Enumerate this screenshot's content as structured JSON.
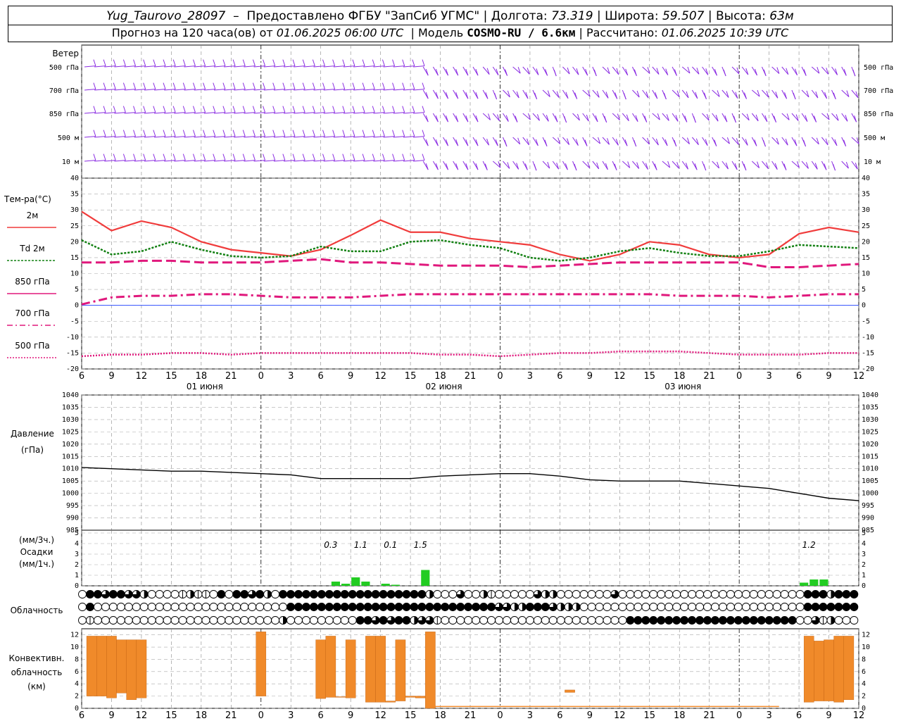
{
  "header": {
    "station": "Yug_Taurovo_28097",
    "provider": "Предоставлено ФГБУ \"ЗапСиб УГМС\"",
    "lon_label": "Долгота:",
    "lon": "73.319",
    "lat_label": "Широта:",
    "lat": "59.507",
    "alt_label": "Высота:",
    "alt": "63м",
    "forecast_label": "Прогноз на 120 часа(ов) от",
    "forecast_start": "01.06.2025 06:00 UTC",
    "model_label": "Модель",
    "model": "COSMO-RU / 6.6км",
    "calc_label": "Рассчитано:",
    "calc_time": "01.06.2025 10:39 UTC"
  },
  "labels": {
    "wind": "Ветер",
    "wind_levels": [
      "500 гПа",
      "700 гПа",
      "850 гПа",
      "500 м",
      "10 м"
    ],
    "temp": "Тем-ра(°С)",
    "legend": [
      "2м",
      "Td 2м",
      "850 гПа",
      "700 гПа",
      "500 гПа"
    ],
    "pressure": [
      "Давление",
      "(гПа)"
    ],
    "precip": [
      "(мм/3ч.)",
      "Осадки",
      "(мм/1ч.)"
    ],
    "cloud": "Облачность",
    "conv": [
      "Конвективн.",
      "облачность",
      "(км)"
    ],
    "days": [
      "01 июня",
      "02 июня",
      "03 июня"
    ]
  },
  "colors": {
    "t2m": "#f03c3c",
    "td": "#128012",
    "t850": "#e0187c",
    "t700": "#e0187c",
    "t500": "#e0187c",
    "wind": "#8a2be2",
    "precip": "#22cc22",
    "conv": "#f08a2a",
    "pressure": "#000000"
  },
  "chart_data": [
    {
      "type": "line",
      "title": "Тем-ра(°С)",
      "x_ticks": [
        "6",
        "9",
        "12",
        "15",
        "18",
        "21",
        "0",
        "3",
        "6",
        "9",
        "12",
        "15",
        "18",
        "21",
        "0",
        "3",
        "6",
        "9",
        "12",
        "15",
        "18",
        "21",
        "0",
        "3",
        "6",
        "9",
        "12"
      ],
      "hours_from_start": [
        0,
        3,
        6,
        9,
        12,
        15,
        18,
        21,
        24,
        27,
        30,
        33,
        36,
        39,
        42,
        45,
        48,
        51,
        54,
        57,
        60,
        63,
        66,
        69,
        72,
        75,
        78
      ],
      "ylim": [
        -20,
        40
      ],
      "series": [
        {
          "name": "2м",
          "values": [
            29.5,
            23.5,
            26.5,
            24.5,
            20,
            17.5,
            16.5,
            15.5,
            17.5,
            22,
            26.8,
            23,
            23,
            21,
            20,
            19,
            16,
            14,
            16,
            20,
            19,
            16,
            15,
            16,
            22.5,
            24.5,
            23
          ]
        },
        {
          "name": "Td 2м",
          "values": [
            20.5,
            16,
            17,
            20,
            17.5,
            15.5,
            15,
            15.5,
            18.5,
            17,
            17,
            20,
            20.5,
            19,
            18,
            15,
            14,
            15,
            17,
            18,
            16.5,
            15.5,
            15.5,
            17,
            19,
            18.5,
            18
          ]
        },
        {
          "name": "850 гПа",
          "values": [
            13.5,
            13.5,
            14,
            14,
            13.5,
            13.5,
            13.5,
            14,
            14.5,
            13.5,
            13.5,
            13,
            12.5,
            12.5,
            12.5,
            12,
            12.5,
            13,
            13.5,
            13.5,
            13.5,
            13.5,
            13.5,
            12,
            12,
            12.5,
            13
          ]
        },
        {
          "name": "700 гПа",
          "values": [
            0.3,
            2.5,
            3,
            3,
            3.5,
            3.5,
            3,
            2.5,
            2.5,
            2.5,
            3,
            3.5,
            3.5,
            3.5,
            3.5,
            3.5,
            3.5,
            3.5,
            3.5,
            3.5,
            3,
            3,
            3,
            2.5,
            3,
            3.5,
            3.5
          ]
        },
        {
          "name": "500 гПа",
          "values": [
            -16,
            -15.5,
            -15.5,
            -15,
            -15,
            -15.5,
            -15,
            -15,
            -15,
            -15,
            -15,
            -15,
            -15.5,
            -15.5,
            -16,
            -15.5,
            -15,
            -15,
            -14.5,
            -14.5,
            -14.5,
            -15,
            -15.5,
            -15.5,
            -15.5,
            -15,
            -15
          ]
        }
      ]
    },
    {
      "type": "line",
      "title": "Давление (гПа)",
      "hours_from_start": [
        0,
        3,
        6,
        9,
        12,
        15,
        18,
        21,
        24,
        27,
        30,
        33,
        36,
        39,
        42,
        45,
        48,
        51,
        54,
        57,
        60,
        63,
        66,
        69,
        72,
        75,
        78
      ],
      "ylim": [
        985,
        1040
      ],
      "y_ticks": [
        985,
        990,
        995,
        1000,
        1005,
        1010,
        1015,
        1020,
        1025,
        1030,
        1035,
        1040
      ],
      "series": [
        {
          "name": "",
          "values": [
            1010.5,
            1010,
            1009.5,
            1009,
            1009,
            1008.5,
            1008,
            1007.5,
            1006,
            1006,
            1006,
            1006,
            1007,
            1007.5,
            1008,
            1008,
            1007,
            1005.5,
            1005,
            1005,
            1005,
            1004,
            1003,
            1002,
            1000,
            998,
            997
          ]
        }
      ]
    },
    {
      "type": "bar",
      "title": "Осадки",
      "ylim": [
        0,
        5
      ],
      "y_ticks": [
        0,
        1,
        2,
        3,
        4,
        5
      ],
      "hours_from_start": [
        25.5,
        26.5,
        27.5,
        28.5,
        29.5,
        30.5,
        31.5,
        32.5,
        33.5,
        34.5,
        72.5,
        73.5,
        74.5
      ],
      "values_mm_1h": [
        0.4,
        0.2,
        0.8,
        0.4,
        0,
        0.2,
        0.1,
        0,
        0,
        1.5,
        0.3,
        0.6,
        0.6
      ],
      "labels_3h": [
        {
          "hour": 25,
          "text": "0.3"
        },
        {
          "hour": 28,
          "text": "1.1"
        },
        {
          "hour": 31,
          "text": "0.1"
        },
        {
          "hour": 34,
          "text": "1.5"
        },
        {
          "hour": 73,
          "text": "1.2"
        }
      ]
    },
    {
      "type": "heatmap",
      "title": "Облачность",
      "rows": [
        "upper",
        "middle",
        "lower"
      ],
      "levels_note": "0=clear,1=quarter,2=half,3=three-quarter,4=overcast",
      "upper": [
        0,
        4,
        4,
        3,
        4,
        4,
        3,
        3,
        2,
        0,
        0,
        0,
        0,
        1,
        2,
        1,
        1,
        0,
        4,
        0,
        4,
        4,
        3,
        4,
        2,
        0,
        4,
        4,
        4,
        4,
        4,
        4,
        4,
        4,
        4,
        4,
        4,
        4,
        4,
        4,
        4,
        4,
        4,
        4,
        4,
        2,
        0,
        0,
        0,
        3,
        0,
        0,
        2,
        1,
        0,
        0,
        0,
        0,
        0,
        3,
        2,
        2,
        0,
        0,
        0,
        0,
        0,
        0,
        0,
        3,
        0,
        0,
        0,
        0,
        0,
        0,
        0,
        0,
        0,
        0,
        0,
        0,
        0,
        0,
        0,
        0,
        0,
        0,
        0,
        0,
        0,
        0,
        0,
        0,
        4,
        4,
        4,
        2,
        4,
        4,
        4
      ],
      "middle": [
        0,
        4,
        0,
        0,
        0,
        0,
        0,
        0,
        0,
        0,
        0,
        0,
        0,
        0,
        0,
        0,
        0,
        0,
        0,
        0,
        0,
        0,
        0,
        0,
        0,
        0,
        0,
        4,
        4,
        4,
        4,
        4,
        4,
        4,
        4,
        4,
        4,
        4,
        4,
        4,
        4,
        4,
        4,
        4,
        4,
        4,
        4,
        4,
        4,
        4,
        4,
        4,
        4,
        4,
        3,
        3,
        2,
        2,
        4,
        4,
        4,
        3,
        2,
        2,
        2,
        0,
        0,
        0,
        0,
        0,
        0,
        0,
        0,
        0,
        0,
        0,
        0,
        0,
        0,
        0,
        0,
        0,
        0,
        0,
        0,
        0,
        0,
        0,
        0,
        0,
        0,
        0,
        0,
        0,
        4,
        4,
        4,
        4,
        4,
        4,
        4
      ],
      "lower": [
        0,
        1,
        0,
        0,
        0,
        0,
        0,
        0,
        0,
        0,
        0,
        0,
        0,
        0,
        0,
        0,
        0,
        0,
        0,
        0,
        0,
        0,
        0,
        0,
        0,
        0,
        2,
        0,
        0,
        0,
        0,
        0,
        0,
        0,
        0,
        0,
        4,
        4,
        3,
        4,
        3,
        4,
        4,
        2,
        3,
        3,
        1,
        0,
        0,
        0,
        0,
        0,
        0,
        0,
        0,
        0,
        0,
        0,
        0,
        0,
        0,
        0,
        0,
        0,
        0,
        0,
        0,
        0,
        0,
        0,
        0,
        4,
        4,
        4,
        4,
        4,
        4,
        4,
        4,
        4,
        4,
        4,
        4,
        4,
        4,
        4,
        4,
        4,
        4,
        4,
        4,
        4,
        4,
        0,
        0,
        3,
        1,
        2
      ]
    },
    {
      "type": "bar",
      "title": "Конвективн. облачность (км)",
      "ylim": [
        0,
        13
      ],
      "y_ticks": [
        0,
        2,
        4,
        6,
        8,
        10,
        12
      ],
      "segments": [
        {
          "h0": 0.5,
          "h1": 1.5,
          "base": 2,
          "top": 11.8
        },
        {
          "h0": 1.5,
          "h1": 2.5,
          "base": 2,
          "top": 11.8
        },
        {
          "h0": 2.5,
          "h1": 3.5,
          "base": 1.7,
          "top": 11.8
        },
        {
          "h0": 3.5,
          "h1": 4.5,
          "base": 2.5,
          "top": 11.2
        },
        {
          "h0": 4.5,
          "h1": 5.5,
          "base": 1.4,
          "top": 11.2
        },
        {
          "h0": 5.5,
          "h1": 6.5,
          "base": 1.7,
          "top": 11.2
        },
        {
          "h0": 17.5,
          "h1": 18.5,
          "base": 2,
          "top": 12.5
        },
        {
          "h0": 23.5,
          "h1": 24.5,
          "base": 1.6,
          "top": 11.2
        },
        {
          "h0": 24.5,
          "h1": 25.5,
          "base": 1.8,
          "top": 11.8
        },
        {
          "h0": 25.5,
          "h1": 26.5,
          "base": 1.8,
          "top": 1.9
        },
        {
          "h0": 26.5,
          "h1": 27.5,
          "base": 1.7,
          "top": 11.2
        },
        {
          "h0": 28.5,
          "h1": 29.5,
          "base": 1,
          "top": 11.8
        },
        {
          "h0": 29.5,
          "h1": 30.5,
          "base": 1,
          "top": 11.8
        },
        {
          "h0": 30.5,
          "h1": 31.5,
          "base": 1,
          "top": 1.2
        },
        {
          "h0": 31.5,
          "h1": 32.5,
          "base": 1.2,
          "top": 11.2
        },
        {
          "h0": 32.5,
          "h1": 33.5,
          "base": 1.8,
          "top": 2
        },
        {
          "h0": 33.5,
          "h1": 34.5,
          "base": 1.7,
          "top": 2
        },
        {
          "h0": 34.5,
          "h1": 35.5,
          "base": 0,
          "top": 12.5
        },
        {
          "h0": 48.5,
          "h1": 49.5,
          "base": 2.6,
          "top": 3
        },
        {
          "h0": 72.5,
          "h1": 73.5,
          "base": 1,
          "top": 11.8
        },
        {
          "h0": 73.5,
          "h1": 74.5,
          "base": 1.2,
          "top": 11
        },
        {
          "h0": 74.5,
          "h1": 75.5,
          "base": 1.2,
          "top": 11.2
        },
        {
          "h0": 75.5,
          "h1": 76.5,
          "base": 1,
          "top": 11.8
        },
        {
          "h0": 76.5,
          "h1": 77.5,
          "base": 1.4,
          "top": 11.8
        }
      ]
    }
  ]
}
